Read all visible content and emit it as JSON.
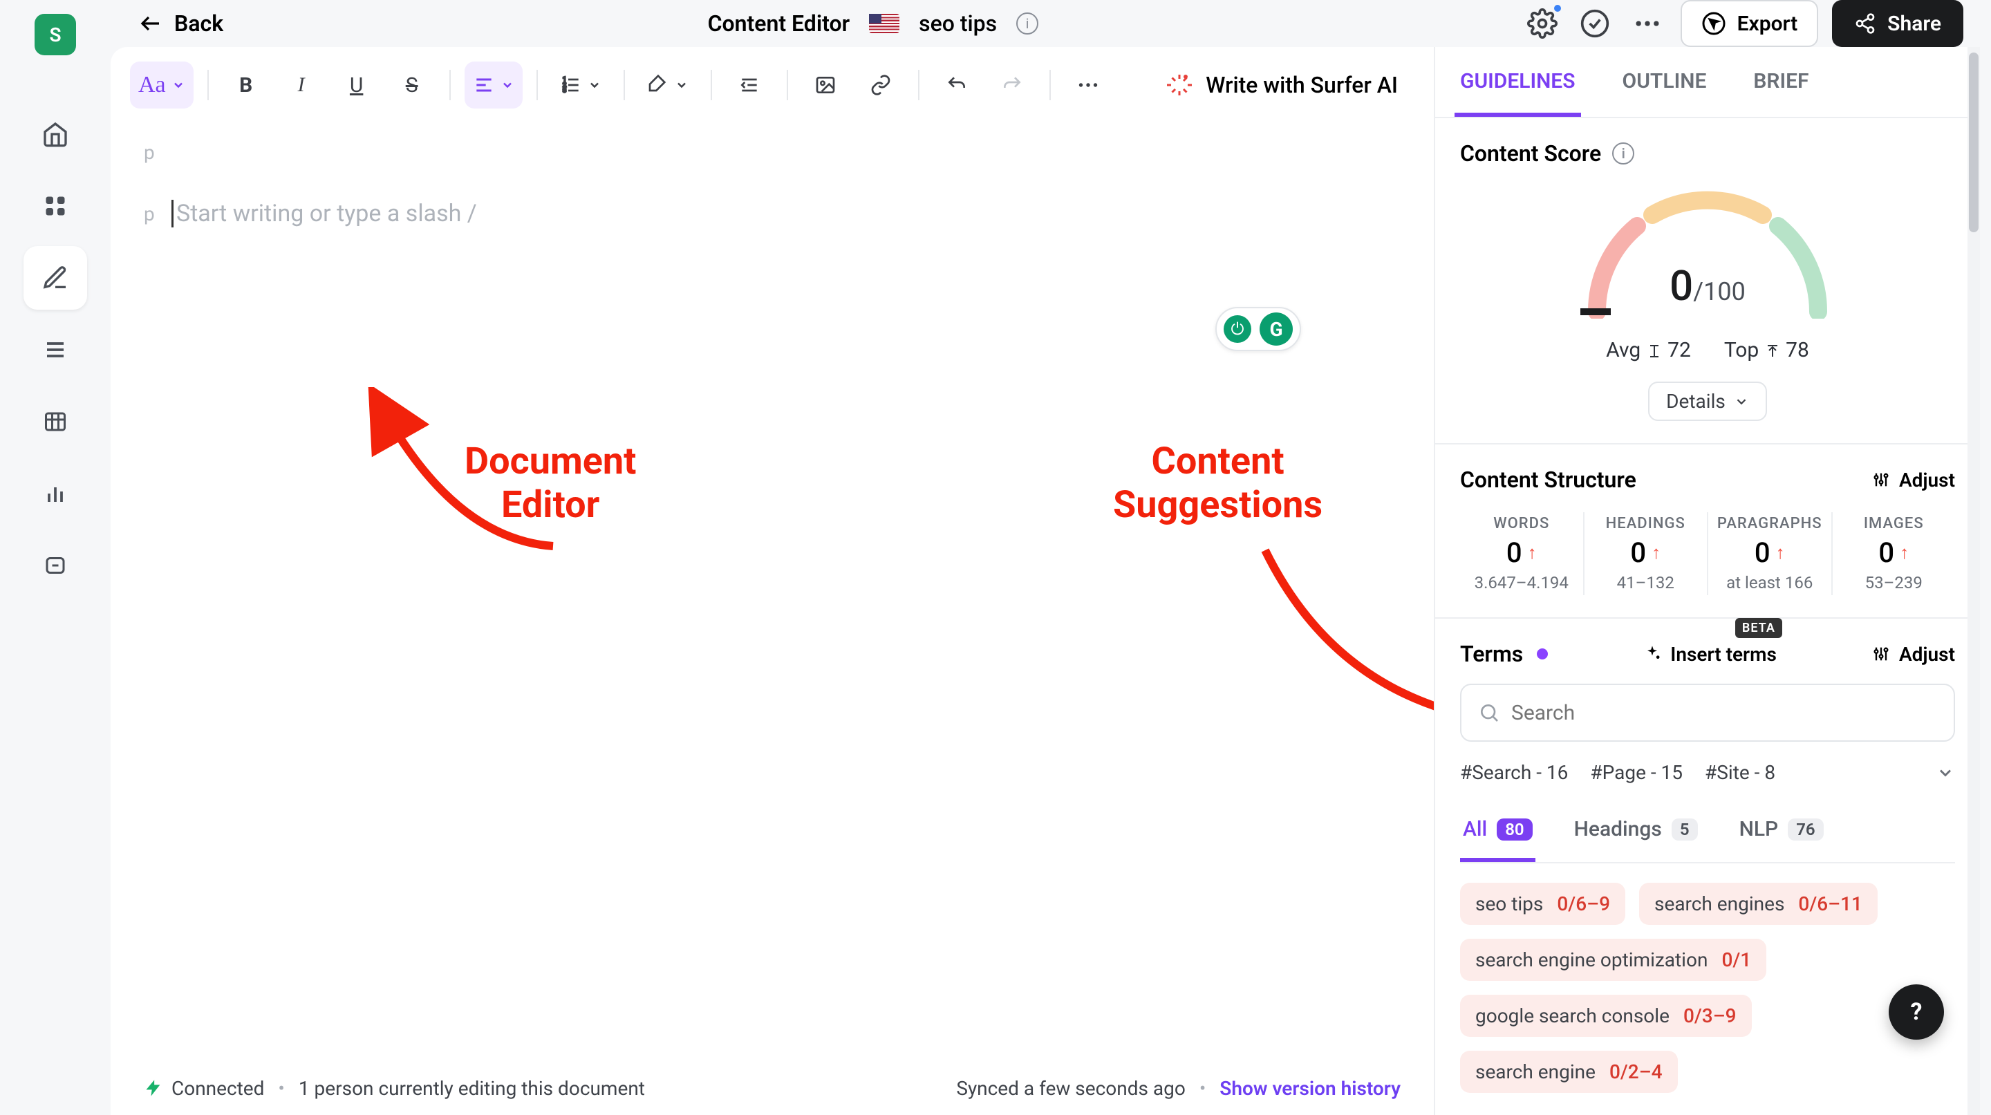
{
  "leftnav": {
    "avatar_letter": "S"
  },
  "header": {
    "back_label": "Back",
    "title": "Content Editor",
    "keyword": "seo tips",
    "export_label": "Export",
    "share_label": "Share"
  },
  "toolbar": {
    "ai_label": "Write with Surfer AI"
  },
  "editor": {
    "tag1": "p",
    "tag2": "p",
    "placeholder": "Start writing or type a slash /"
  },
  "annotations": {
    "doc_label_1": "Document",
    "doc_label_2": "Editor",
    "sugg_label_1": "Content",
    "sugg_label_2": "Suggestions"
  },
  "status": {
    "connected": "Connected",
    "editing": "1 person currently editing this document",
    "synced": "Synced a few seconds ago",
    "version_link": "Show version history"
  },
  "sidebar": {
    "tabs": {
      "guidelines": "GUIDELINES",
      "outline": "OUTLINE",
      "brief": "BRIEF"
    },
    "score": {
      "title": "Content Score",
      "value": "0",
      "max": "/100",
      "avg_label": "Avg",
      "avg_val": "72",
      "top_label": "Top",
      "top_val": "78",
      "details": "Details"
    },
    "structure": {
      "title": "Content Structure",
      "adjust": "Adjust",
      "cols": [
        {
          "label": "WORDS",
          "val": "0",
          "range": "3.647–4.194"
        },
        {
          "label": "HEADINGS",
          "val": "0",
          "range": "41–132"
        },
        {
          "label": "PARAGRAPHS",
          "val": "0",
          "range": "at least 166"
        },
        {
          "label": "IMAGES",
          "val": "0",
          "range": "53–239"
        }
      ]
    },
    "terms": {
      "title": "Terms",
      "insert": "Insert terms",
      "beta": "BETA",
      "adjust": "Adjust",
      "search_placeholder": "Search",
      "hashes": [
        "#Search - 16",
        "#Page - 15",
        "#Site - 8"
      ],
      "subtabs": {
        "all": "All",
        "all_count": "80",
        "headings": "Headings",
        "headings_count": "5",
        "nlp": "NLP",
        "nlp_count": "76"
      },
      "chips": [
        {
          "name": "seo tips",
          "num": "0/6–9"
        },
        {
          "name": "search engines",
          "num": "0/6–11"
        },
        {
          "name": "search engine optimization",
          "num": "0/1"
        },
        {
          "name": "google search console",
          "num": "0/3–9"
        },
        {
          "name": "search engine",
          "num": "0/2–4"
        }
      ]
    }
  },
  "help": "?"
}
